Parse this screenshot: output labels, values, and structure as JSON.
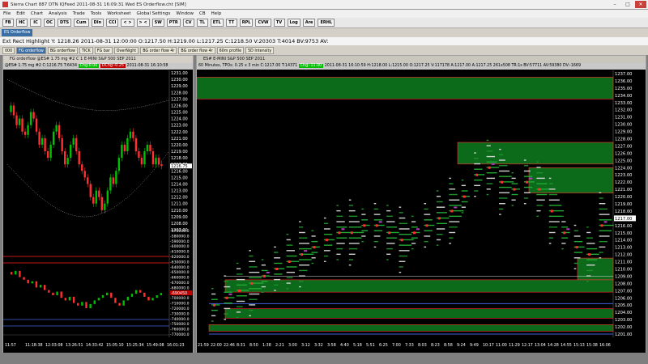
{
  "window": {
    "title": "Sierra Chart 887 DTN IQFeed 2011-08-31  16:09:31  Wed  ES Orderflow.cht [SIM]",
    "min": "–",
    "max": "□",
    "close": "✕"
  },
  "menu": [
    "File",
    "Edit",
    "Chart",
    "Analysis",
    "Trade",
    "Tools",
    "Worksheet",
    "Global Settings",
    "Window",
    "CB",
    "Help"
  ],
  "toolbar": [
    "FB",
    "HC",
    "IC",
    "OC",
    "DTS",
    "Cum",
    "DIn",
    "CCI",
    "< >",
    "> <",
    "SW",
    "PTR",
    "CV",
    "TL",
    "ETL",
    "TT",
    "RPL",
    "CVW",
    "TV",
    "Log",
    "Are",
    "ERHL"
  ],
  "chartbook_tab": "ES Orderflow",
  "info_line": "Ext Rect Highlight  Y: 1218.26  2011-08-31  12:00:00  O:1217.50  H:1219.00  L:1217.25  C:1218.50  V:20303  T:4014  BV:9753  AV:",
  "tabs": [
    "000",
    "FG orderflow",
    "BG orderflow",
    "TICK",
    "FG bar",
    "OverNight",
    "BG order flow 4r",
    "BG order flow 4r",
    "60m profile",
    "5D Intensity"
  ],
  "left_window": {
    "title": "FG orderflow  @ES#  1.75 mg  #2  C 1  E-MINI S&P 500 SEP 2011",
    "strip_prefix": "@ES#  1.75 mg  #2",
    "strip_vals": "C:1216.75  T:6434",
    "chg": "Chg:0.00",
    "dchg": "DChg:-0.25",
    "time_label": "2011-08-31 16:10:58",
    "price_ticks": [
      "1231.00",
      "1230.00",
      "1229.00",
      "1228.00",
      "1227.00",
      "1226.00",
      "1225.00",
      "1224.00",
      "1223.00",
      "1222.00",
      "1221.00",
      "1220.00",
      "1219.00",
      "1218.00",
      "1217.00",
      "1216.00",
      "1215.00",
      "1214.00",
      "1213.00",
      "1212.00",
      "1211.00",
      "1210.00",
      "1209.00",
      "1208.00",
      "1207.00"
    ],
    "price_last": "1216.75",
    "delta_ticks": [
      "-570000.0",
      "-580000.0",
      "-590000.0",
      "-600000.0",
      "-610000.0",
      "-620000.0",
      "-630000.0",
      "-640000.0",
      "-650000.0",
      "-660000.0",
      "-670000.0",
      "-680000.0",
      "-690000.0",
      "-700000.0",
      "-710000.0",
      "-720000.0",
      "-730000.0",
      "-740000.0",
      "-750000.0",
      "-760000.0",
      "-770000.0"
    ],
    "delta_last": "-690450",
    "time_ticks": [
      "11:57",
      "11:18:38",
      "12:03:08",
      "13:26:51",
      "14:33:42",
      "15:05:10",
      "15:25:34",
      "15:49:08",
      "16:01:23"
    ]
  },
  "right_window": {
    "title": "ES#  E-MINI S&P 500 SEP 2011",
    "strip_prefix": "60 Minutes, TPOs: 0.25 x 3 min",
    "strip_vals1": "C:1217.00",
    "strip_vals2": "T:14371",
    "chg": "Chg:-11.00",
    "strip_rest": "2011-08-31 16:10:59  H:1218.00  L:1215.00  O:1217.25  V:117178  A:1217.00  A:1217.25  261x508  TR:1s  BV:57711  AV:59380  DV:-1669",
    "price_ticks": [
      "1237.00",
      "1236.00",
      "1235.00",
      "1234.00",
      "1233.00",
      "1232.00",
      "1231.00",
      "1230.00",
      "1229.00",
      "1228.00",
      "1227.00",
      "1226.00",
      "1225.00",
      "1224.00",
      "1223.00",
      "1222.00",
      "1221.00",
      "1220.00",
      "1219.00",
      "1218.00",
      "1217.00",
      "1216.00",
      "1215.00",
      "1214.00",
      "1213.00",
      "1212.00",
      "1211.00",
      "1210.00",
      "1209.00",
      "1208.00",
      "1207.00",
      "1206.00",
      "1205.00",
      "1204.00",
      "1203.00",
      "1202.00",
      "1201.00"
    ],
    "price_last": "1217.00",
    "time_ticks": [
      "21:59",
      "22:00",
      "22:46",
      "8:31",
      "8:50",
      "1:38",
      "2:21",
      "3:00",
      "3:12",
      "3:32",
      "3:58",
      "4:40",
      "5:18",
      "5:51",
      "6:25",
      "7:00",
      "7:33",
      "8:03",
      "8:23",
      "8:58",
      "9:24",
      "9:49",
      "10:17",
      "11:00",
      "11:29",
      "12:17",
      "13:04",
      "14:28",
      "14:55",
      "15:13",
      "15:38",
      "16:06"
    ]
  },
  "colors": {
    "background": "#000000",
    "up_bar": "#00c000",
    "down_bar": "#ff3030",
    "green_zone": "#0b6b1b",
    "green_zone_border": "#ff3030",
    "blue_line": "#3f5fd8",
    "red_line": "#ff2020",
    "white_line": "#e0e0e0"
  }
}
